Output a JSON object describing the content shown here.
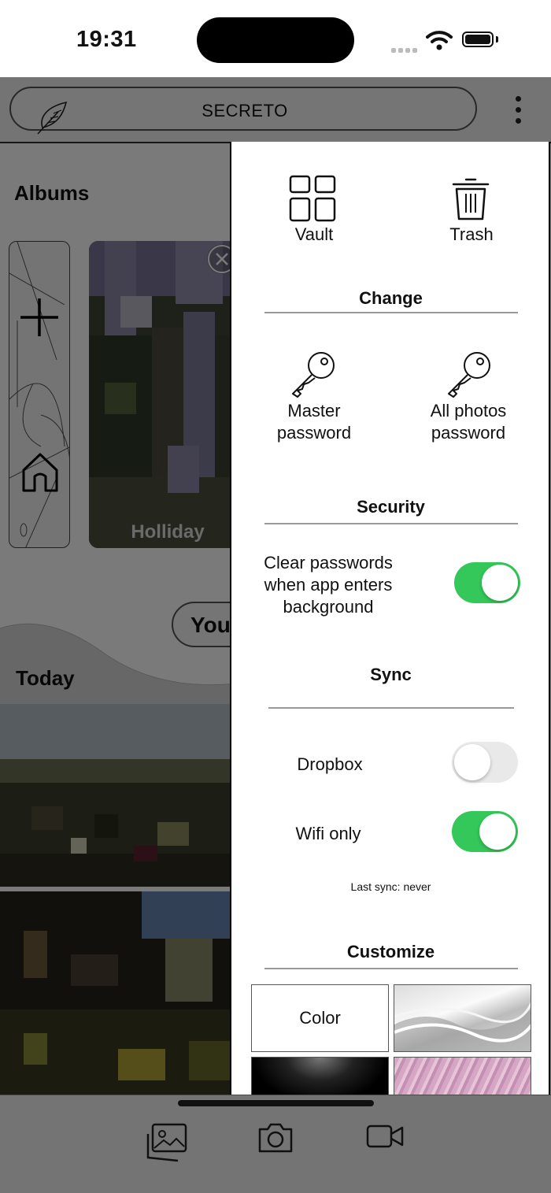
{
  "status_bar": {
    "time": "19:31"
  },
  "app": {
    "title": "SECRETO",
    "albums_heading": "Albums",
    "album_name": "Holliday",
    "pill_partial": "You",
    "today_heading": "Today"
  },
  "menu": {
    "vault_label": "Vault",
    "trash_label": "Trash",
    "change_heading": "Change",
    "master_password_line1": "Master",
    "master_password_line2": "password",
    "all_photos_password_line1": "All photos",
    "all_photos_password_line2": "password",
    "security_heading": "Security",
    "clear_passwords_line1": "Clear passwords",
    "clear_passwords_line2": "when app enters",
    "clear_passwords_line3": "background",
    "clear_passwords_on": true,
    "sync_heading": "Sync",
    "dropbox_label": "Dropbox",
    "dropbox_on": false,
    "wifi_only_label": "Wifi only",
    "wifi_only_on": true,
    "last_sync": "Last sync: never",
    "customize_heading": "Customize",
    "color_tile_label": "Color"
  },
  "colors": {
    "toggle_on": "#34c759",
    "toggle_off": "#e9e9ea"
  },
  "icons": [
    "feather-icon",
    "more-vertical-icon",
    "grid-icon",
    "trash-icon",
    "key-icon",
    "photos-icon",
    "camera-icon",
    "video-icon",
    "plus-icon",
    "home-icon",
    "close-icon"
  ]
}
